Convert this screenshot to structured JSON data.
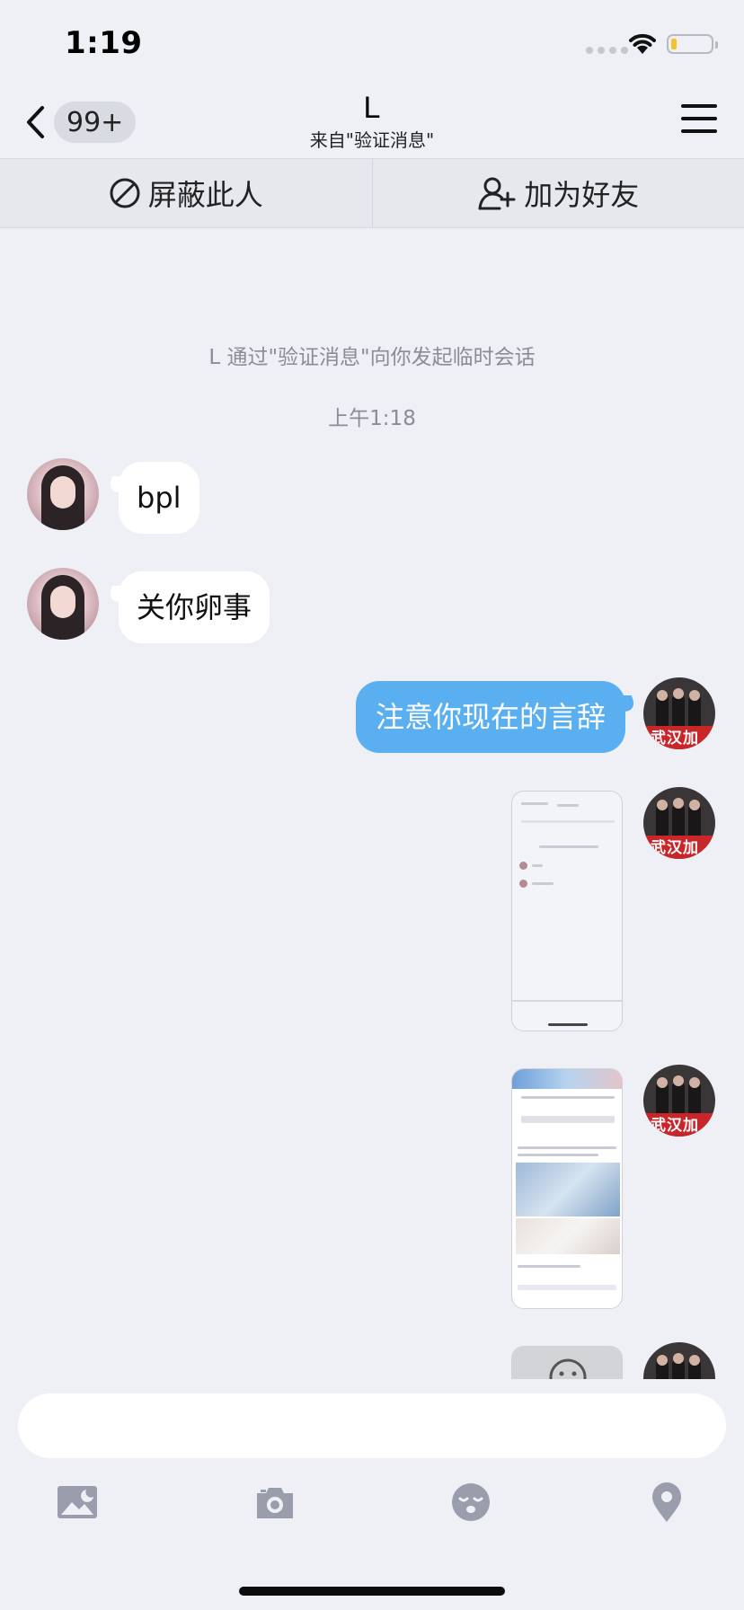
{
  "status_bar": {
    "time": "1:19",
    "wifi_icon": "wifi-icon",
    "battery_icon": "battery-icon"
  },
  "nav": {
    "back_icon": "chevron-left-icon",
    "unread_badge": "99+",
    "title": "L",
    "subtitle": "来自\"验证消息\"",
    "menu_icon": "hamburger-menu-icon"
  },
  "actions": {
    "block": {
      "label": "屏蔽此人",
      "icon": "block-icon"
    },
    "add_friend": {
      "label": "加为好友",
      "icon": "add-user-icon"
    }
  },
  "chat": {
    "system_notice": "L 通过\"验证消息\"向你发起临时会话",
    "timestamp": "上午1:18",
    "messages": [
      {
        "side": "left",
        "type": "text",
        "text": "bpl"
      },
      {
        "side": "left",
        "type": "text",
        "text": "关你卵事"
      },
      {
        "side": "right",
        "type": "text",
        "text": "注意你现在的言辞"
      },
      {
        "side": "right",
        "type": "image",
        "image": "screenshot-thumbnail"
      },
      {
        "side": "right",
        "type": "image",
        "image": "screenshot-thumbnail"
      },
      {
        "side": "right",
        "type": "image",
        "image": "screenshot-thumbnail"
      }
    ]
  },
  "composer": {
    "placeholder": ""
  },
  "toolbar": [
    {
      "name": "photo",
      "icon": "image-icon"
    },
    {
      "name": "camera",
      "icon": "camera-icon"
    },
    {
      "name": "emoji",
      "icon": "emoji-icon"
    },
    {
      "name": "location",
      "icon": "location-icon"
    }
  ],
  "colors": {
    "background": "#eef0f6",
    "self_bubble": "#5aaff0",
    "other_bubble": "#ffffff",
    "toolbar_icon": "#9a9eac"
  }
}
